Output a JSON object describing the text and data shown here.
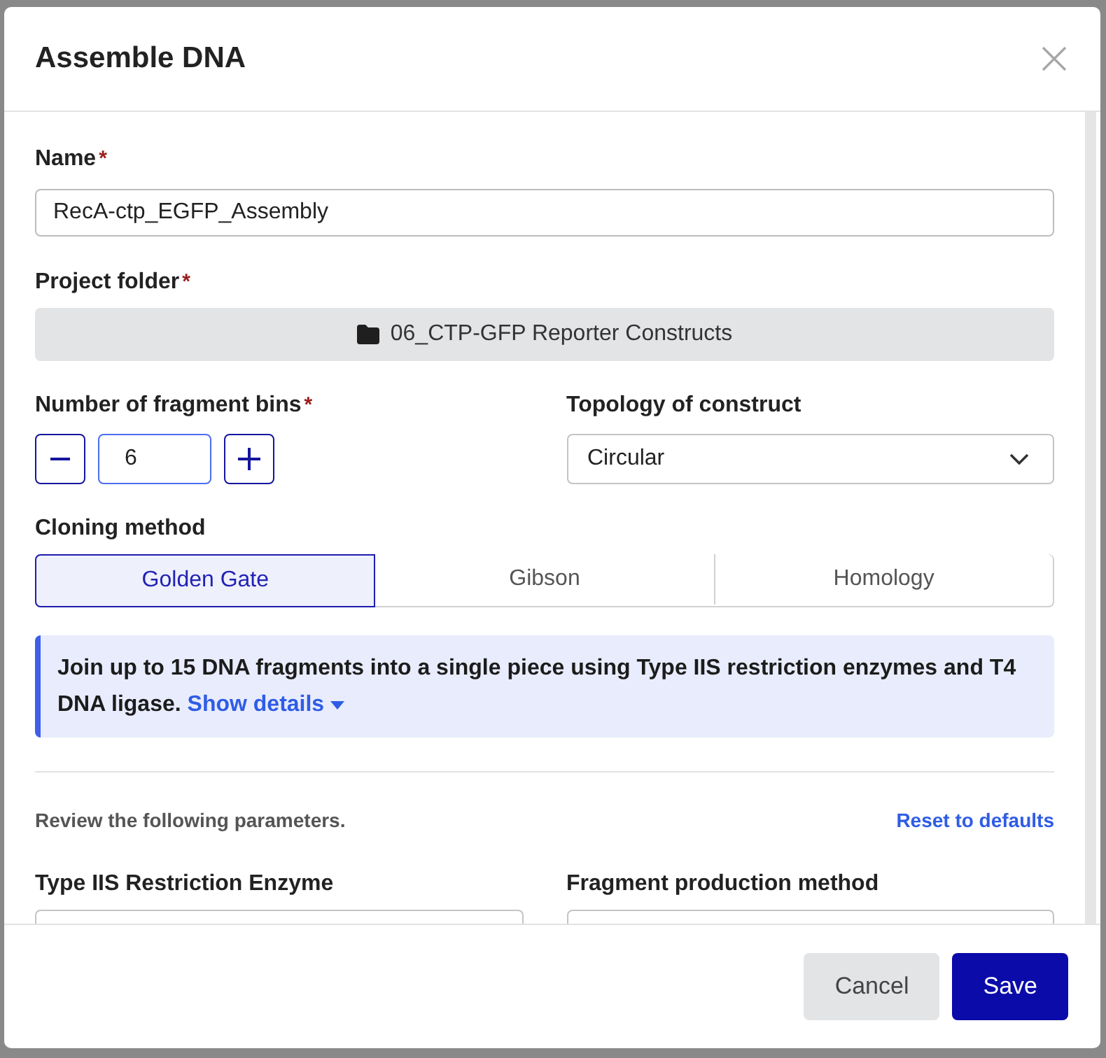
{
  "dialog": {
    "title": "Assemble DNA"
  },
  "name_field": {
    "label": "Name",
    "required_mark": "*",
    "value": "RecA-ctp_EGFP_Assembly"
  },
  "project_folder": {
    "label": "Project folder",
    "required_mark": "*",
    "value": "06_CTP-GFP Reporter Constructs"
  },
  "fragment_bins": {
    "label": "Number of fragment bins",
    "required_mark": "*",
    "value": "6"
  },
  "topology": {
    "label": "Topology of construct",
    "value": "Circular"
  },
  "cloning_method": {
    "label": "Cloning method",
    "options": [
      {
        "label": "Golden Gate",
        "selected": true
      },
      {
        "label": "Gibson",
        "selected": false
      },
      {
        "label": "Homology",
        "selected": false
      }
    ]
  },
  "info": {
    "text": "Join up to 15 DNA fragments into a single piece using Type IIS restriction enzymes and T4 DNA ligase.",
    "link": "Show details"
  },
  "review": {
    "text": "Review the following parameters.",
    "reset_link": "Reset to defaults"
  },
  "parameters": [
    {
      "label": "Type IIS Restriction Enzyme"
    },
    {
      "label": "Fragment production method"
    }
  ],
  "buttons": [
    {
      "label": "Cancel",
      "kind": "secondary"
    },
    {
      "label": "Save",
      "kind": "primary"
    }
  ]
}
